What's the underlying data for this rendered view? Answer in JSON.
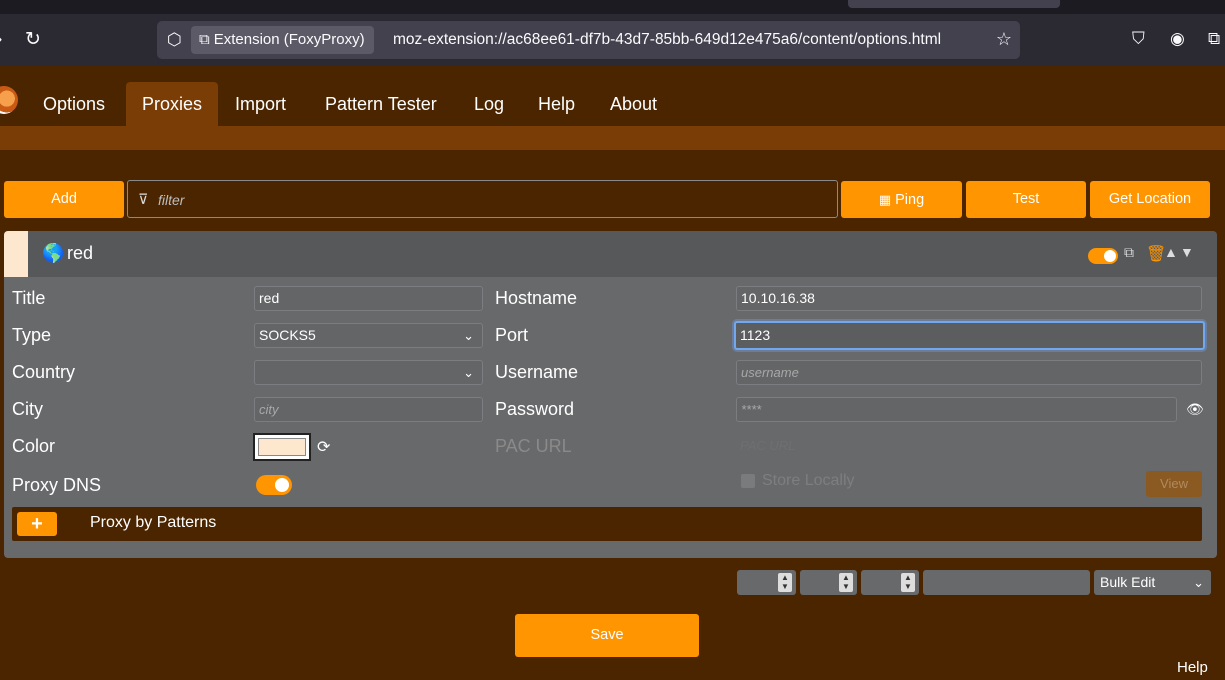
{
  "browser": {
    "nav_back_icon": "arrow-left-icon",
    "reload_icon": "reload-icon",
    "extension_pill": "Extension (FoxyProxy)",
    "url": "moz-extension://ac68ee61-df7b-43d7-85bb-649d12e475a6/content/options.html"
  },
  "nav": {
    "tabs": [
      {
        "label": "Options"
      },
      {
        "label": "Proxies",
        "active": true
      },
      {
        "label": "Import"
      },
      {
        "label": "Pattern Tester"
      },
      {
        "label": "Log"
      },
      {
        "label": "Help"
      },
      {
        "label": "About"
      }
    ]
  },
  "toolbar": {
    "add_label": "Add",
    "filter_placeholder": "filter",
    "ping_label": "Ping",
    "test_label": "Test",
    "get_location_label": "Get Location"
  },
  "proxy": {
    "name": "red",
    "color": "#fde7cf",
    "enabled": true,
    "fields": {
      "title_label": "Title",
      "title_value": "red",
      "type_label": "Type",
      "type_value": "SOCKS5",
      "country_label": "Country",
      "country_value": "",
      "city_label": "City",
      "city_placeholder": "city",
      "color_label": "Color",
      "proxy_dns_label": "Proxy DNS",
      "proxy_dns_enabled": true,
      "hostname_label": "Hostname",
      "hostname_value": "10.10.16.38",
      "port_label": "Port",
      "port_value": "1123",
      "username_label": "Username",
      "username_placeholder": "username",
      "password_label": "Password",
      "password_placeholder": "****",
      "pac_url_label": "PAC URL",
      "pac_url_placeholder": "PAC URL",
      "store_locally_label": "Store Locally",
      "view_label": "View"
    },
    "patterns_label": "Proxy by Patterns"
  },
  "bulk": {
    "selected": "Bulk Edit"
  },
  "save_label": "Save",
  "footer_help": "Help",
  "colors": {
    "accent": "#ff9500",
    "background": "#4a2500",
    "tab_active": "#7a3d05"
  }
}
